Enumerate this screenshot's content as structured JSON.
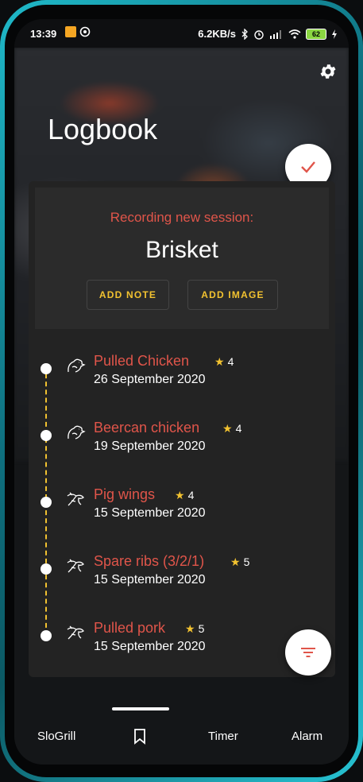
{
  "status_bar": {
    "time": "13:39",
    "speed": "6.2KB/s",
    "battery": "62"
  },
  "header": {
    "title": "Logbook"
  },
  "recording": {
    "label": "Recording new session:",
    "session_name": "Brisket",
    "add_note_label": "ADD NOTE",
    "add_image_label": "ADD IMAGE"
  },
  "entries": [
    {
      "name": "Pulled Chicken",
      "rating": "4",
      "date": "26 September 2020",
      "icon": "chicken-icon"
    },
    {
      "name": "Beercan chicken",
      "rating": "4",
      "date": "19 September 2020",
      "icon": "chicken-icon"
    },
    {
      "name": "Pig wings",
      "rating": "4",
      "date": "15 September 2020",
      "icon": "pig-icon"
    },
    {
      "name": "Spare ribs (3/2/1)",
      "rating": "5",
      "date": "15 September 2020",
      "icon": "pig-icon"
    },
    {
      "name": "Pulled pork",
      "rating": "5",
      "date": "15 September 2020",
      "icon": "pig-icon"
    }
  ],
  "nav": {
    "slogrill": "SloGrill",
    "timer": "Timer",
    "alarm": "Alarm"
  },
  "colors": {
    "accent_red": "#e0554a",
    "accent_yellow": "#f2c230",
    "card_bg": "#232323"
  }
}
